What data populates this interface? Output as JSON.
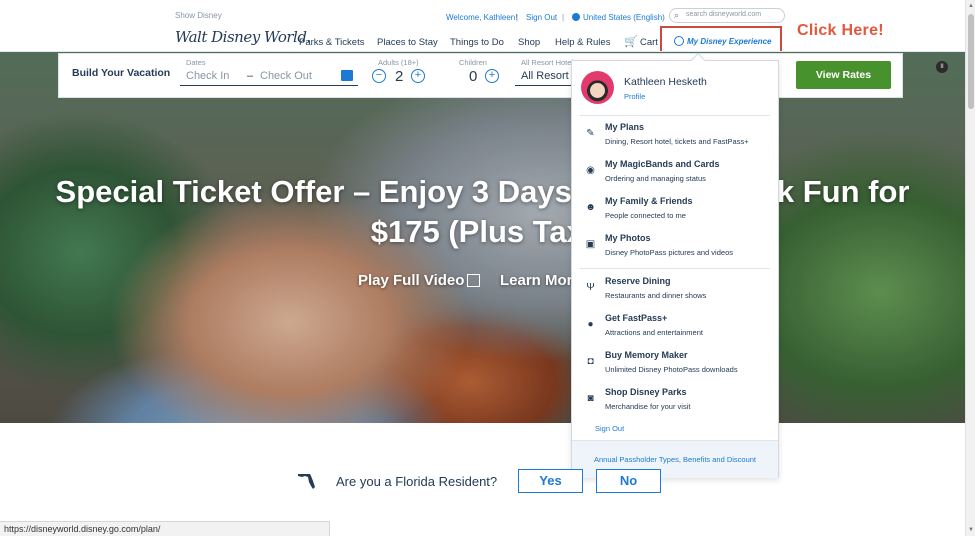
{
  "header": {
    "show_disney": "Show Disney",
    "welcome": "Welcome, Kathleen!",
    "sign_out": "Sign Out",
    "region": "United States (English)",
    "search_placeholder": "search disneyworld.com",
    "logo": "Walt Disney World.",
    "nav": [
      "Parks & Tickets",
      "Places to Stay",
      "Things to Do",
      "Shop",
      "Help & Rules",
      "Cart"
    ],
    "my_disney_experience": "My Disney Experience"
  },
  "annotation": {
    "click_here": "Click Here!",
    "color": "#e2583e"
  },
  "booking": {
    "title": "Build Your Vacation",
    "dates_label": "Dates",
    "check_in": "Check In",
    "check_out": "Check Out",
    "adults_label": "Adults (18+)",
    "adults": "2",
    "children_label": "Children",
    "children": "0",
    "resort_label": "All Resort Hotels",
    "resort_value": "All Resort Hotels",
    "view_rates": "View Rates",
    "dash": "–",
    "minus": "−",
    "plus": "+"
  },
  "hero": {
    "title_line1": "Special Ticket Offer – Enjoy 3 Days of Theme Park Fun for",
    "title_line2": "$175 (Plus Tax)",
    "play_video": "Play Full Video",
    "learn_more": "Learn More",
    "pause": "II"
  },
  "dropdown": {
    "user_name": "Kathleen Hesketh",
    "profile": "Profile",
    "items": [
      {
        "title": "My Plans",
        "sub": "Dining, Resort hotel, tickets and FastPass+",
        "icon": "✎"
      },
      {
        "title": "My MagicBands and Cards",
        "sub": "Ordering and managing status",
        "icon": "◉"
      },
      {
        "title": "My Family & Friends",
        "sub": "People connected to me",
        "icon": "☻"
      },
      {
        "title": "My Photos",
        "sub": "Disney PhotoPass pictures and videos",
        "icon": "▣"
      },
      {
        "title": "Reserve Dining",
        "sub": "Restaurants and dinner shows",
        "icon": "Ψ"
      },
      {
        "title": "Get FastPass+",
        "sub": "Attractions and entertainment",
        "icon": "●"
      },
      {
        "title": "Buy Memory Maker",
        "sub": "Unlimited Disney PhotoPass downloads",
        "icon": "◘"
      },
      {
        "title": "Shop Disney Parks",
        "sub": "Merchandise for your visit",
        "icon": "◙"
      }
    ],
    "sign_out": "Sign Out",
    "footer": "Annual Passholder Types, Benefits and Discount"
  },
  "florida": {
    "question": "Are you a Florida Resident?",
    "yes": "Yes",
    "no": "No"
  },
  "status": {
    "url": "https://disneyworld.disney.go.com/plan/"
  },
  "icons": {
    "search": "⌕",
    "cart": "🛒",
    "scroll_up": "▲",
    "scroll_down": "▼"
  },
  "colors": {
    "brand_blue": "#1d7ad4",
    "navy": "#253b56",
    "green": "#47922d",
    "highlight": "#c94a3f"
  }
}
